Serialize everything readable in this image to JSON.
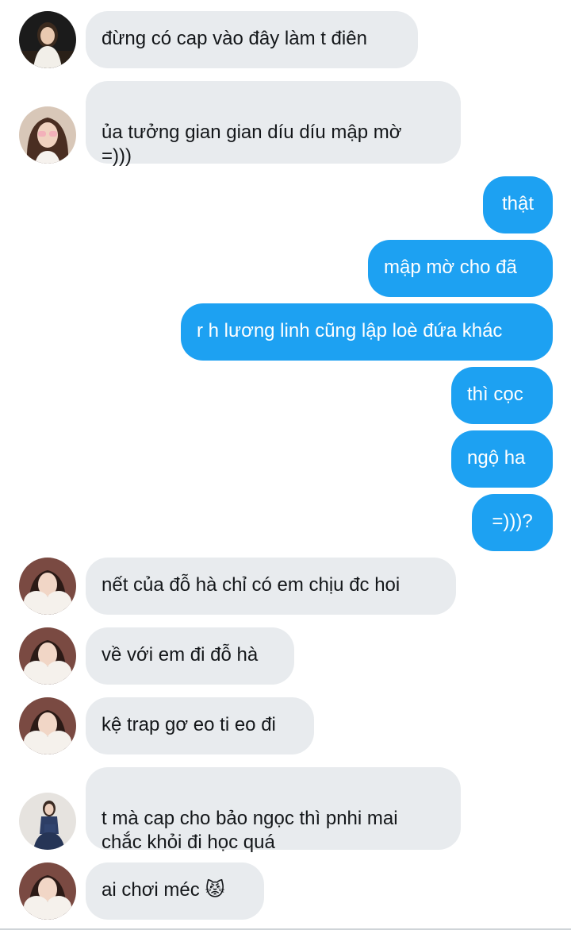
{
  "conversation": {
    "messages": [
      {
        "text": "đừng có cap vào đây làm t điên",
        "direction": "incoming",
        "avatar": "girl-dark-outfit-avatar"
      },
      {
        "text": "ủa tưởng gian gian díu díu mập mờ\n=)))",
        "direction": "incoming",
        "avatar": "girl-pink-glasses-avatar"
      },
      {
        "text": "thật",
        "direction": "outgoing"
      },
      {
        "text": "mập mờ cho đã",
        "direction": "outgoing"
      },
      {
        "text": "r h lương linh cũng lập loè đứa khác",
        "direction": "outgoing"
      },
      {
        "text": "thì cọc",
        "direction": "outgoing"
      },
      {
        "text": "ngộ ha",
        "direction": "outgoing"
      },
      {
        "text": "=)))?",
        "direction": "outgoing"
      },
      {
        "text": "nết của đỗ hà chỉ có em chịu đc hoi",
        "direction": "incoming",
        "avatar": "girl-white-fur-avatar"
      },
      {
        "text": "về với em đi đỗ hà",
        "direction": "incoming",
        "avatar": "girl-white-fur-avatar"
      },
      {
        "text": "kệ trap gơ eo ti eo đi",
        "direction": "incoming",
        "avatar": "girl-white-fur-avatar"
      },
      {
        "text": "t mà cap cho bảo ngọc thì pnhi mai\nchắc khỏi đi học quá",
        "direction": "incoming",
        "avatar": "girl-blue-dress-avatar"
      },
      {
        "text": "ai chơi méc 😾",
        "direction": "incoming",
        "avatar": "girl-white-fur-avatar"
      }
    ]
  },
  "colors": {
    "incoming_bubble": "#e8ebee",
    "incoming_text": "#14171a",
    "outgoing_bubble": "#1da1f2",
    "outgoing_text": "#ffffff"
  }
}
